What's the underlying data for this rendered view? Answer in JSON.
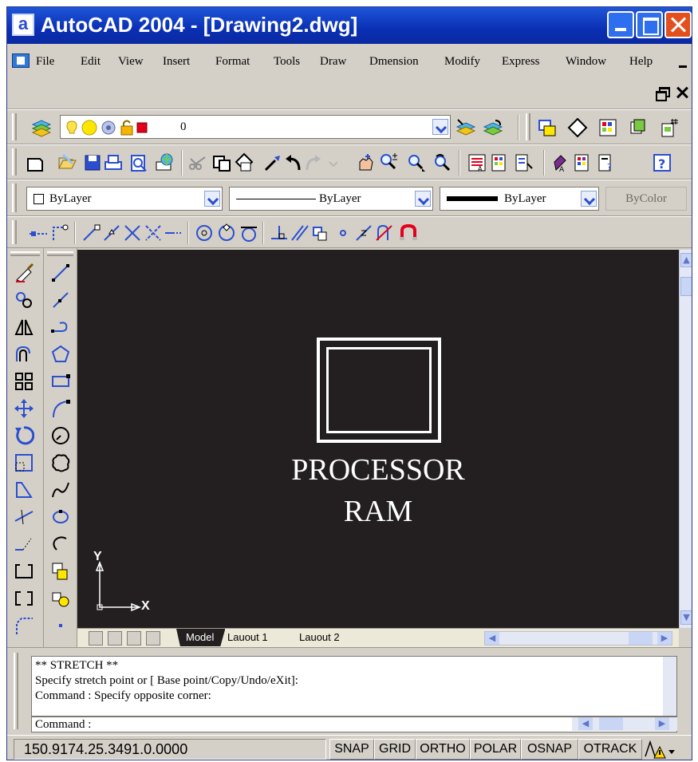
{
  "window": {
    "app_icon_letter": "a",
    "title": "AutoCAD 2004 - [Drawing2.dwg]"
  },
  "menu": {
    "items": [
      "File",
      "Edit",
      "View",
      "Insert",
      "Format",
      "Tools",
      "Draw",
      "Dmension",
      "Modify",
      "Express",
      "Window",
      "Help"
    ]
  },
  "layers": {
    "current_layer": "0"
  },
  "properties": {
    "color": "ByLayer",
    "linetype": "ByLayer",
    "lineweight": "ByLayer",
    "plot_style": "ByColor"
  },
  "drawing": {
    "label_line1": "PROCESSOR",
    "label_line2": "RAM",
    "ucs_x": "X",
    "ucs_y": "Y",
    "background_color": "#231f20"
  },
  "layout_tabs": [
    "Model",
    "Lauout 1",
    "Lauout 2"
  ],
  "command_window": {
    "history": [
      "** STRETCH **",
      "Specify stretch point or [ Base point/Copy/Undo/eXit]:",
      "Command : Specify opposite corner:"
    ],
    "prompt": "Command :"
  },
  "status_bar": {
    "coordinates": "150.9174.25.3491.0.0000",
    "toggles": [
      "SNAP",
      "GRID",
      "ORTHO",
      "POLAR",
      "OSNAP",
      "OTRACK"
    ]
  },
  "colors": {
    "title_bar": "#0a2fb4",
    "canvas": "#231f20",
    "chrome": "#d4d0c8",
    "close_button": "#e3501e"
  }
}
